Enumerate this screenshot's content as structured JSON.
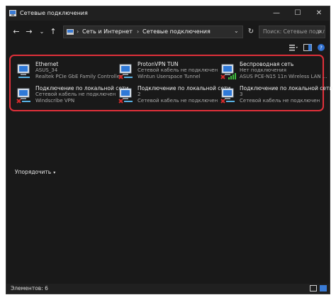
{
  "window": {
    "title": "Сетевые подключения",
    "controls": {
      "minimize": "—",
      "maximize": "☐",
      "close": "✕"
    }
  },
  "nav": {
    "back": "←",
    "forward": "→",
    "recent": "⌄",
    "up": "↑",
    "breadcrumb": [
      "Сеть и Интернет",
      "Сетевые подключения"
    ],
    "separator": "›",
    "dropdown": "⌄",
    "refresh": "↻",
    "search_placeholder": "Поиск: Сетевые подкл..."
  },
  "connections": [
    {
      "name": "Ethernet",
      "status": "ASUS_34",
      "device": "Realtek PCIe GbE Family Controller",
      "icon": "ethernet-icon",
      "state": "connected"
    },
    {
      "name": "ProtonVPN TUN",
      "status": "Сетевой кабель не подключен",
      "device": "Wintun Userspace Tunnel",
      "icon": "ethernet-icon",
      "state": "disconnected"
    },
    {
      "name": "Беспроводная сеть",
      "status": "Нет подключения",
      "device": "ASUS PCE-N15 11n Wireless LAN ...",
      "icon": "wifi-adapter-icon",
      "state": "no-connection"
    },
    {
      "name": "Подключение по локальной сети",
      "status": "Сетевой кабель не подключен",
      "device": "Windscribe VPN",
      "icon": "ethernet-icon",
      "state": "disconnected"
    },
    {
      "name": "Подключение по локальной сети",
      "status": "2",
      "device": "Сетевой кабель не подключен",
      "icon": "ethernet-icon",
      "state": "disconnected"
    },
    {
      "name": "Подключение по локальной сети",
      "status": "3",
      "device": "Сетевой кабель не подключен",
      "icon": "ethernet-icon",
      "state": "disconnected"
    }
  ],
  "toolbar": {
    "sort_label": "Упорядочить",
    "sort_chevron": "▾"
  },
  "status": {
    "items_count": "Элементов: 6"
  },
  "colors": {
    "highlight": "#e0303a",
    "background": "#191919",
    "disconnect": "#d22b2b",
    "signal": "#3fbf3f"
  }
}
